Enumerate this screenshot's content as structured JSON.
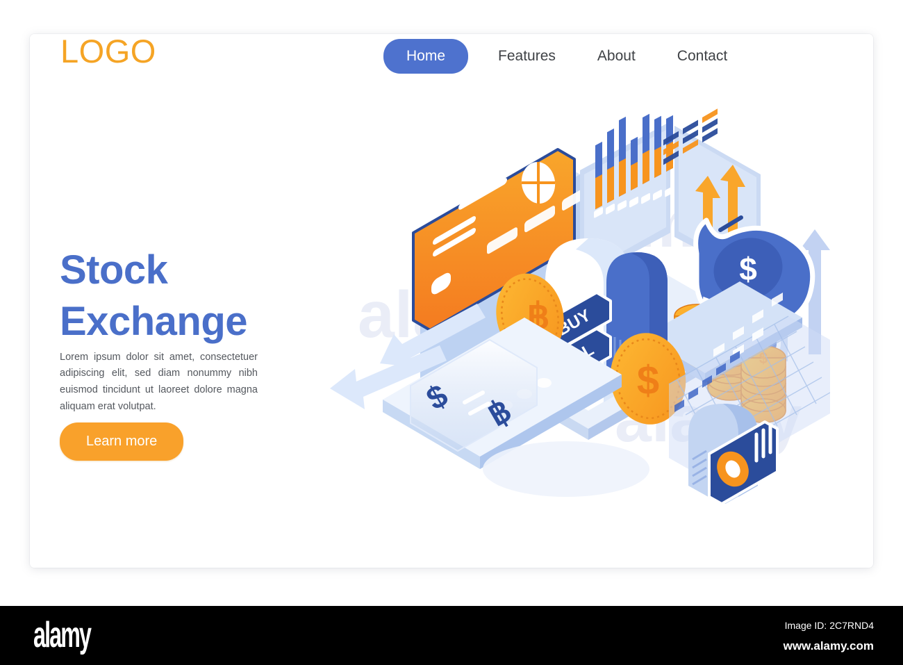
{
  "brand": {
    "logo_text": "LOGO",
    "logo_color": "#f5a425"
  },
  "nav": {
    "items": [
      {
        "label": "Home",
        "active": true
      },
      {
        "label": "Features",
        "active": false
      },
      {
        "label": "About",
        "active": false
      },
      {
        "label": "Contact",
        "active": false
      }
    ],
    "active_bg": "#4e72ce",
    "text_color": "#3f4246"
  },
  "hero": {
    "headline_line1": "Stock",
    "headline_line2": "Exchange",
    "headline_color": "#4a6fc9",
    "paragraph": "Lorem ipsum dolor sit amet, consectetuer adipiscing elit, sed diam nonummy nibh euismod tincidunt ut laoreet dolore magna aliquam erat volutpat.",
    "cta_label": "Learn more",
    "cta_color": "#f9a12b"
  },
  "illustration": {
    "name": "isometric-stock-exchange-scene",
    "trade_buttons": {
      "buy_label": "BUY",
      "sell_label": "SELL"
    },
    "exchange_panel": {
      "from_symbol": "$",
      "equals": "=",
      "to_symbol": "฿"
    },
    "piggy_bank_symbol": "$",
    "coin_symbols": {
      "bitcoin": "฿",
      "dollar": "$"
    },
    "coin_stack_symbol": "$",
    "accent_orange": "#f7941e",
    "accent_blue": "#4a6fc9",
    "light_blue": "#bed1ee",
    "pale_blue": "#dce6f7",
    "bar_chart": {
      "type": "bar",
      "series_top_color": "#4a6fc9",
      "series_bottom_color": "#f7941e",
      "values": [
        62,
        70,
        78,
        46,
        66,
        56,
        50
      ],
      "bar_count": 7
    },
    "growth_arrows_count": 3,
    "trend_arrows_count": 2
  },
  "footer": {
    "watermark_brand": "alamy",
    "image_id_label": "Image ID: 2C7RND4",
    "url": "www.alamy.com",
    "bg": "#000000"
  }
}
